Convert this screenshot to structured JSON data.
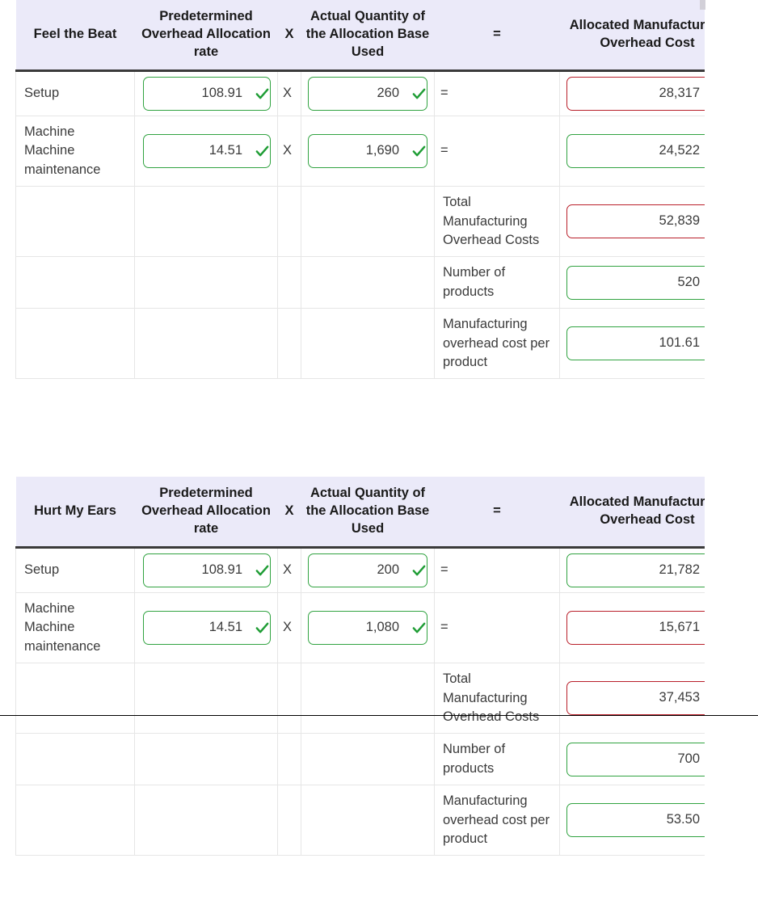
{
  "tables": [
    {
      "id": "feel-the-beat",
      "headers": {
        "name": "Feel the Beat",
        "rate": "Predetermined Overhead Allocation rate",
        "x": "X",
        "qty": "Actual Quantity of the Allocation Base Used",
        "eq": "=",
        "alloc": "Allocated Manufacturing Overhead Cost"
      },
      "rows": [
        {
          "kind": "activity",
          "name": "Setup",
          "rate": {
            "value": "108.91",
            "status": "correct"
          },
          "op": "X",
          "qty": {
            "value": "260",
            "status": "correct"
          },
          "eq": "=",
          "alloc": {
            "value": "28,317",
            "status": "incorrect"
          }
        },
        {
          "kind": "activity",
          "name": "Machine Machine maintenance",
          "rate": {
            "value": "14.51",
            "status": "correct"
          },
          "op": "X",
          "qty": {
            "value": "1,690",
            "status": "correct"
          },
          "eq": "=",
          "alloc": {
            "value": "24,522",
            "status": "correct"
          }
        },
        {
          "kind": "summary",
          "label": "Total Manufacturing Overhead Costs",
          "alloc": {
            "value": "52,839",
            "status": "incorrect"
          }
        },
        {
          "kind": "summary",
          "label": "Number of products",
          "alloc": {
            "value": "520",
            "status": "correct"
          }
        },
        {
          "kind": "summary",
          "label": "Manufacturing overhead cost per product",
          "alloc": {
            "value": "101.61",
            "status": "correct"
          }
        }
      ]
    },
    {
      "id": "hurt-my-ears",
      "headers": {
        "name": "Hurt My Ears",
        "rate": "Predetermined Overhead Allocation rate",
        "x": "X",
        "qty": "Actual Quantity of the Allocation Base Used",
        "eq": "=",
        "alloc": "Allocated Manufacturing Overhead Cost"
      },
      "rows": [
        {
          "kind": "activity",
          "name": "Setup",
          "rate": {
            "value": "108.91",
            "status": "correct"
          },
          "op": "X",
          "qty": {
            "value": "200",
            "status": "correct"
          },
          "eq": "=",
          "alloc": {
            "value": "21,782",
            "status": "correct"
          }
        },
        {
          "kind": "activity",
          "name": "Machine Machine maintenance",
          "rate": {
            "value": "14.51",
            "status": "correct"
          },
          "op": "X",
          "qty": {
            "value": "1,080",
            "status": "correct"
          },
          "eq": "=",
          "alloc": {
            "value": "15,671",
            "status": "incorrect"
          }
        },
        {
          "kind": "summary",
          "label": "Total Manufacturing Overhead Costs",
          "alloc": {
            "value": "37,453",
            "status": "incorrect"
          }
        },
        {
          "kind": "summary",
          "label": "Number of products",
          "alloc": {
            "value": "700",
            "status": "correct"
          }
        },
        {
          "kind": "summary",
          "label": "Manufacturing overhead cost per product",
          "alloc": {
            "value": "53.50",
            "status": "correct"
          }
        }
      ]
    }
  ],
  "icons": {
    "correct": "check-icon",
    "incorrect": "cross-icon"
  },
  "colors": {
    "header_background": "#ebeaf9",
    "header_text": "#1a1a1a",
    "correct_border": "#31a341",
    "correct_mark": "#1f9d35",
    "incorrect_border": "#b9202b",
    "incorrect_mark": "#c1121f",
    "grid_line": "#e6e6e6",
    "header_underline": "#3a3a3a",
    "body_text": "#3b3b3b"
  }
}
